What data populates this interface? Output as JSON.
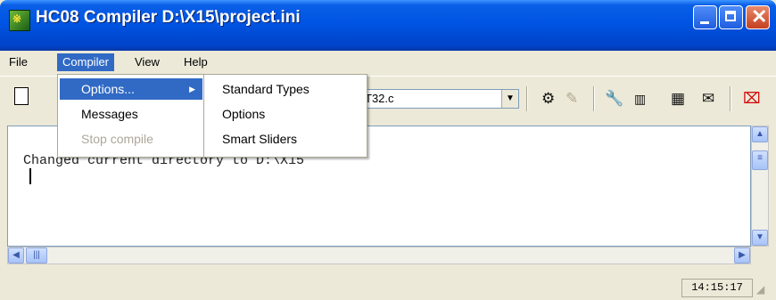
{
  "window": {
    "title": "HC08 Compiler  D:\\X15\\project.ini",
    "icon": "app-icon"
  },
  "menubar": [
    "File",
    "Compiler",
    "View",
    "Help"
  ],
  "compiler_menu": [
    {
      "label": "Options...",
      "has_submenu": true,
      "highlighted": true
    },
    {
      "label": "Messages",
      "disabled": false
    },
    {
      "label": "Stop compile",
      "disabled": true
    }
  ],
  "options_submenu": [
    "Standard Types",
    "Options",
    "Smart Sliders"
  ],
  "toolbar": {
    "file_combo_value": "T32.c"
  },
  "output": {
    "line1": "Changed current directory to D:\\X15"
  },
  "status": {
    "time": "14:15:17"
  },
  "colors": {
    "titlebar": "#0054e3",
    "highlight": "#316ac5",
    "face": "#ece9d8"
  }
}
